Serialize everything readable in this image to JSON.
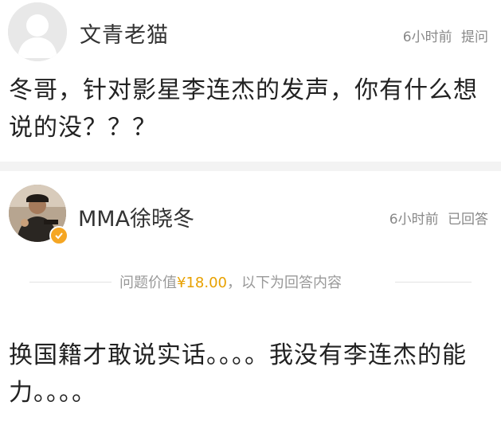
{
  "question": {
    "asker_name": "文青老猫",
    "time": "6小时前",
    "action": "提问",
    "text": "冬哥，针对影星李连杰的发声，你有什么想说的没？？？",
    "avatar_icon": "default-user-icon"
  },
  "answer": {
    "answerer_name": "MMA徐晓冬",
    "time": "6小时前",
    "status": "已回答",
    "avatar_icon": "user-photo-avatar",
    "verified_icon": "verified-badge-icon",
    "price_prefix": "问题价值",
    "price": "¥18.00",
    "price_suffix": "，以下为回答内容",
    "text": "换国籍才敢说实话。。。。我没有李连杰的能力。。。。"
  },
  "colors": {
    "accent_price": "#e8a100",
    "badge": "#f5a623",
    "meta_text": "#888888"
  }
}
